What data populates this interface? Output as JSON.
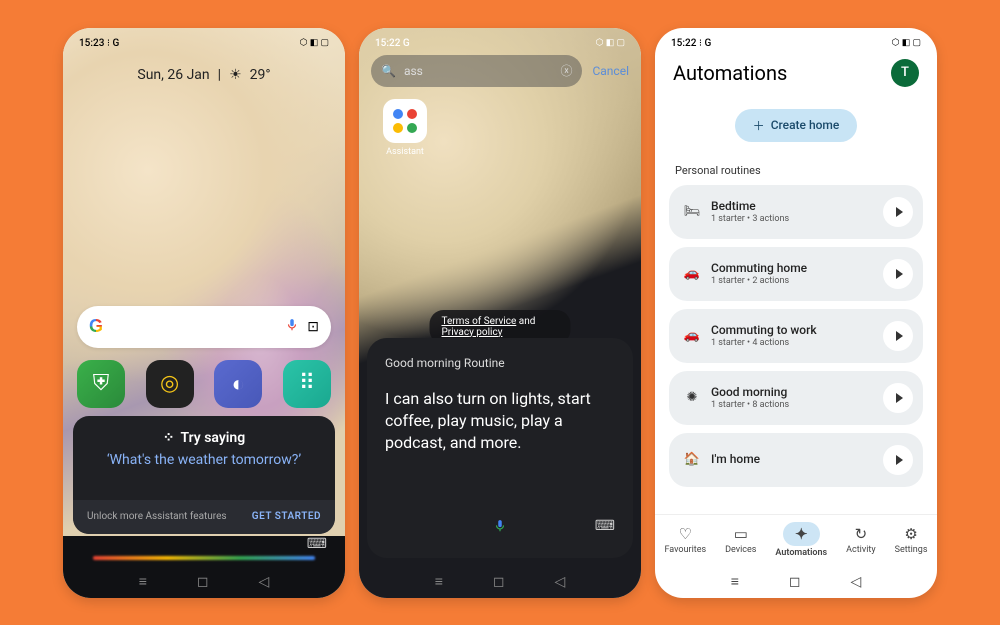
{
  "phone1": {
    "status": {
      "time": "15:23",
      "extra": "⁝ G",
      "right": "⬡ ◧ ▢"
    },
    "date": "Sun, 26 Jan",
    "weather_icon": "☀",
    "temp": "29°",
    "assistant": {
      "try_label": "Try saying",
      "quote": "‘What's the weather tomorrow?’",
      "unlock": "Unlock more Assistant features",
      "get_started": "GET STARTED"
    },
    "app_icons": [
      "shield-icon",
      "target-icon",
      "globe-icon",
      "apps-icon"
    ]
  },
  "phone2": {
    "status": {
      "time": "15:22",
      "extra": "G",
      "right": "⬡ ◧ ▢"
    },
    "search": {
      "query": "ass",
      "cancel": "Cancel"
    },
    "result_label": "Assistant",
    "legal": {
      "tos": "Terms of Service",
      "and": " and ",
      "pp": "Privacy policy"
    },
    "panel": {
      "title": "Good morning Routine",
      "body": "I can also turn on lights, start coffee, play music, play a podcast, and more."
    }
  },
  "phone3": {
    "status": {
      "time": "15:22",
      "extra": "⁝ G",
      "right": "⬡ ◧ ▢"
    },
    "title": "Automations",
    "avatar_letter": "T",
    "create_label": "Create home",
    "section": "Personal routines",
    "routines": [
      {
        "icon": "🛏",
        "name": "Bedtime",
        "sub": "1 starter • 3 actions"
      },
      {
        "icon": "🚗",
        "name": "Commuting home",
        "sub": "1 starter • 2 actions"
      },
      {
        "icon": "🚗",
        "name": "Commuting to work",
        "sub": "1 starter • 4 actions"
      },
      {
        "icon": "✺",
        "name": "Good morning",
        "sub": "1 starter • 8 actions"
      },
      {
        "icon": "🏠",
        "name": "I'm home",
        "sub": ""
      }
    ],
    "tabs": [
      {
        "icon": "♡",
        "label": "Favourites"
      },
      {
        "icon": "▭",
        "label": "Devices"
      },
      {
        "icon": "✦",
        "label": "Automations",
        "active": true
      },
      {
        "icon": "↻",
        "label": "Activity"
      },
      {
        "icon": "⚙",
        "label": "Settings"
      }
    ]
  }
}
